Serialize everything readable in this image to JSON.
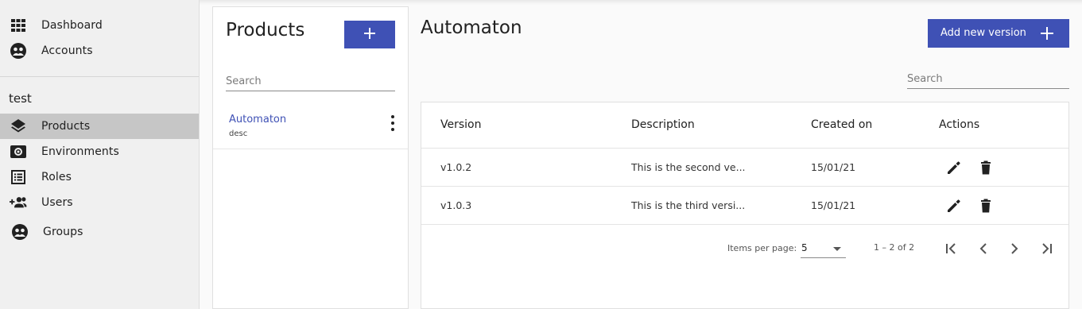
{
  "sidebar": {
    "top_items": [
      {
        "label": "Dashboard",
        "icon": "grid-icon"
      },
      {
        "label": "Accounts",
        "icon": "accounts-icon"
      }
    ],
    "group_title": "test",
    "group_items": [
      {
        "label": "Products",
        "icon": "layers-icon",
        "active": true
      },
      {
        "label": "Environments",
        "icon": "environments-icon"
      },
      {
        "label": "Roles",
        "icon": "list-icon"
      },
      {
        "label": "Users",
        "icon": "group-add-icon"
      },
      {
        "label": "Groups",
        "icon": "groups-icon"
      }
    ]
  },
  "products_panel": {
    "title": "Products",
    "add_icon": "plus-icon",
    "search_placeholder": "Search",
    "items": [
      {
        "name": "Automaton",
        "description": "desc"
      }
    ]
  },
  "main": {
    "title": "Automaton",
    "add_version_label": "Add new version",
    "search_placeholder": "Search",
    "table": {
      "columns": [
        "Version",
        "Description",
        "Created on",
        "Actions"
      ],
      "rows": [
        {
          "version": "v1.0.2",
          "description": "This is the second ve...",
          "created_on": "15/01/21"
        },
        {
          "version": "v1.0.3",
          "description": "This is the third versi...",
          "created_on": "15/01/21"
        }
      ]
    },
    "paginator": {
      "items_per_page_label": "Items per page:",
      "page_size": "5",
      "range_label": "1 – 2 of 2"
    }
  },
  "colors": {
    "primary": "#3f51b5",
    "sidebar_bg": "#f0f0f0",
    "active_item_bg": "#c6c6c6"
  }
}
